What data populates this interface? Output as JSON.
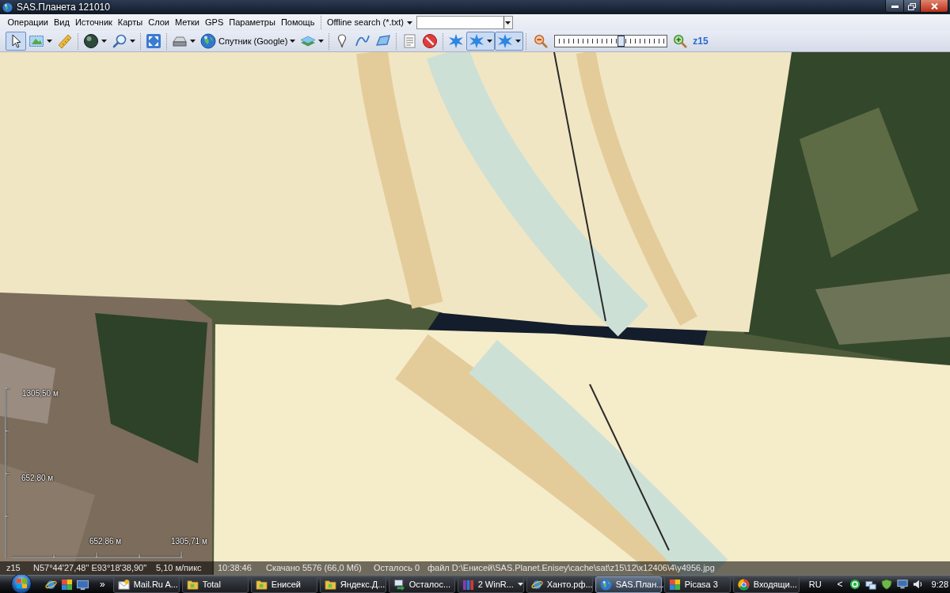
{
  "window": {
    "title": "SAS.Планета 121010"
  },
  "menu": [
    "Операции",
    "Вид",
    "Источник",
    "Карты",
    "Слои",
    "Метки",
    "GPS",
    "Параметры",
    "Помощь"
  ],
  "search": {
    "label": "Offline search (*.txt)"
  },
  "toolbar": [
    [
      {
        "kind": "pointer",
        "selected": true,
        "dropdown": false
      },
      {
        "kind": "area",
        "selected": false,
        "dropdown": true
      },
      {
        "kind": "ruler",
        "selected": false,
        "dropdown": false
      }
    ],
    [
      {
        "kind": "globe",
        "selected": false,
        "dropdown": true
      },
      {
        "kind": "zoom",
        "selected": false,
        "dropdown": true
      }
    ],
    [
      {
        "kind": "fullscreen",
        "selected": false,
        "dropdown": false
      }
    ],
    [
      {
        "kind": "drive",
        "selected": false,
        "dropdown": true
      },
      {
        "kind": "source",
        "label": "Спутник (Google)",
        "selected": false,
        "dropdown": true
      },
      {
        "kind": "layers",
        "selected": false,
        "dropdown": true
      }
    ],
    [
      {
        "kind": "pin",
        "selected": false,
        "dropdown": false
      },
      {
        "kind": "path",
        "selected": false,
        "dropdown": false
      },
      {
        "kind": "polygon",
        "selected": false,
        "dropdown": false
      }
    ],
    [
      {
        "kind": "marks",
        "selected": false,
        "dropdown": false
      },
      {
        "kind": "hide",
        "selected": false,
        "dropdown": false
      }
    ],
    [
      {
        "kind": "gps",
        "selected": false,
        "dropdown": false
      },
      {
        "kind": "gps",
        "selected": true,
        "dropdown": true
      },
      {
        "kind": "gps",
        "selected": true,
        "dropdown": true
      }
    ]
  ],
  "zoom": {
    "level": 0.6,
    "label": "z15"
  },
  "scale": {
    "vertical": [
      "1305,50 м",
      "652,80 м"
    ],
    "horizontal": [
      "652,86 м",
      "1305,71 м"
    ]
  },
  "status_bar": [
    "z15",
    "N57°44'27,48\" E93°18'38,90\"",
    "5,10 м/пикс",
    "10:38:46",
    "Скачано 5576 (66,0 Мб)",
    "Осталось 0",
    "файл D:\\Енисей\\SAS.Planet.Enisey\\cache\\sat\\z15\\12\\x12406\\4\\y4956.jpg"
  ],
  "taskbar": {
    "more": "»",
    "tasks": [
      {
        "kind": "mail",
        "label": "Mail.Ru A...",
        "selected": false,
        "grouped": false
      },
      {
        "kind": "folder",
        "label": "Total",
        "selected": false,
        "grouped": false
      },
      {
        "kind": "folder",
        "label": "Енисей",
        "selected": false,
        "grouped": false
      },
      {
        "kind": "folder",
        "label": "Яндекс.Д...",
        "selected": false,
        "grouped": false
      },
      {
        "kind": "transfer",
        "label": "Осталос...",
        "selected": false,
        "grouped": false
      },
      {
        "kind": "archive",
        "label": "2 WinR...",
        "selected": false,
        "grouped": true
      },
      {
        "kind": "browser",
        "label": "Ханто.рф...",
        "selected": false,
        "grouped": false
      },
      {
        "kind": "globe",
        "label": "SAS.План...",
        "selected": true,
        "grouped": false
      },
      {
        "kind": "picasa",
        "label": "Picasa 3",
        "selected": false,
        "grouped": false
      },
      {
        "kind": "chrome",
        "label": "Входящи...",
        "selected": false,
        "grouped": false
      }
    ],
    "language": "RU",
    "tray_toggle": "<",
    "clock": "9:28"
  }
}
